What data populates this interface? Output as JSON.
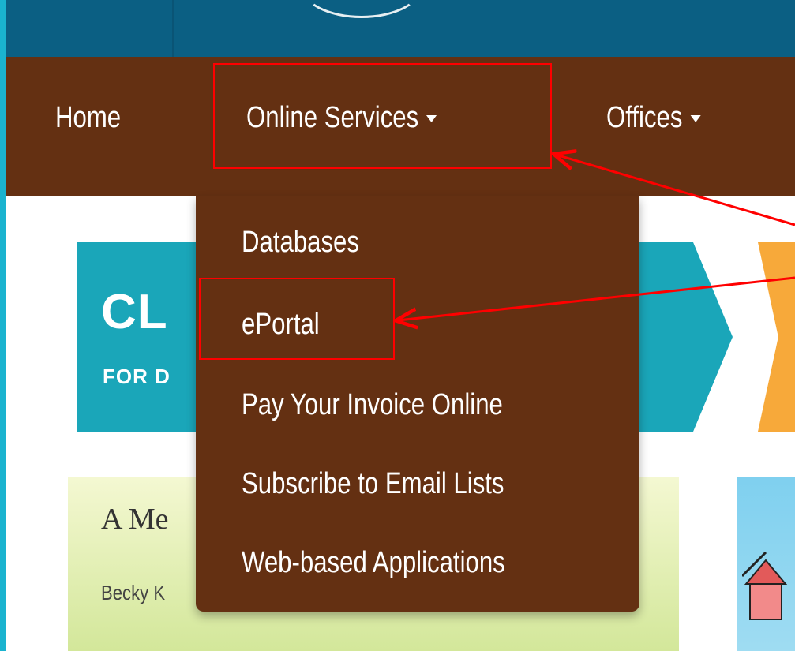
{
  "nav": {
    "home": "Home",
    "online_services": "Online Services",
    "offices": "Offices"
  },
  "dropdown": {
    "items": [
      "Databases",
      "ePortal",
      "Pay Your Invoice Online",
      "Subscribe to Email Lists",
      "Web-based Applications"
    ]
  },
  "banner": {
    "title": "CL",
    "subtitle": "FOR D"
  },
  "card": {
    "heading": "A Me",
    "author": "Becky K"
  },
  "colors": {
    "nav_bg": "#643012",
    "topbar_bg": "#0b5f83",
    "banner_teal": "#1aa6b9",
    "highlight_red": "#ff0000"
  }
}
